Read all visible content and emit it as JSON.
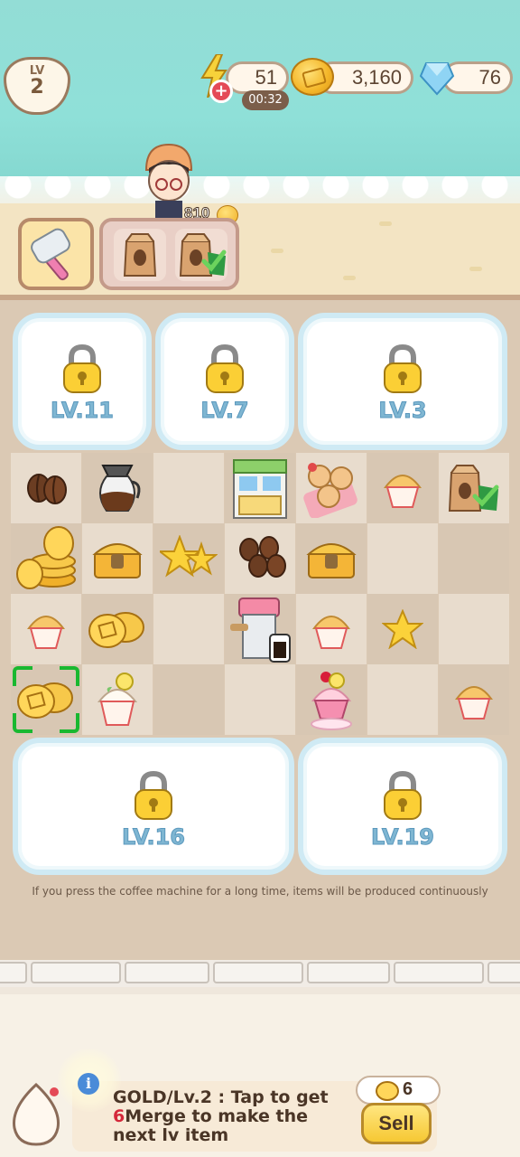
{
  "hud": {
    "level_label": "LV",
    "level_value": "2",
    "energy": "51",
    "energy_timer": "00:32",
    "gold": "3,160",
    "gems": "76"
  },
  "avatar": {
    "score": "810"
  },
  "tools": {
    "hammer_icon": "hammer-icon",
    "bags": [
      "coffee-bag-icon",
      "coffee-bag-check-icon"
    ]
  },
  "board": {
    "locked_zones": [
      {
        "label": "LV.11"
      },
      {
        "label": "LV.7"
      },
      {
        "label": "LV.3"
      },
      {
        "label": "LV.16"
      },
      {
        "label": "LV.19"
      }
    ],
    "items": [
      "coffee-beans-icon",
      "coffee-pot-icon",
      "vending-shop-icon",
      "cat-cookies-icon",
      "cupcake-icon",
      "coffee-bag-check-icon",
      "gold-coin-stack-icon",
      "treasure-chest-icon",
      "star-pair-icon",
      "coffee-beans-pile-icon",
      "treasure-chest-icon",
      "cupcake-icon",
      "gold-coins-icon",
      "coffee-machine-icon",
      "cupcake-icon",
      "star-icon",
      "gold-coins-icon",
      "lemon-cupcake-icon",
      "cherry-cupcake-icon",
      "cupcake-icon"
    ],
    "hint": "If you press the coffee machine for a long time, items will be produced continuously"
  },
  "info": {
    "title": "GOLD/Lv.2 : Tap to get",
    "count": "6",
    "message": "Merge to make the next lv item",
    "sell_price": "6",
    "sell_label": "Sell"
  },
  "colors": {
    "sky": "#8fe0d8",
    "sand": "#f3e4c3",
    "board": "#dbc9b4",
    "lock_text": "#7fb6d2",
    "selection": "#19b830",
    "sell_button": "#f6c833"
  }
}
